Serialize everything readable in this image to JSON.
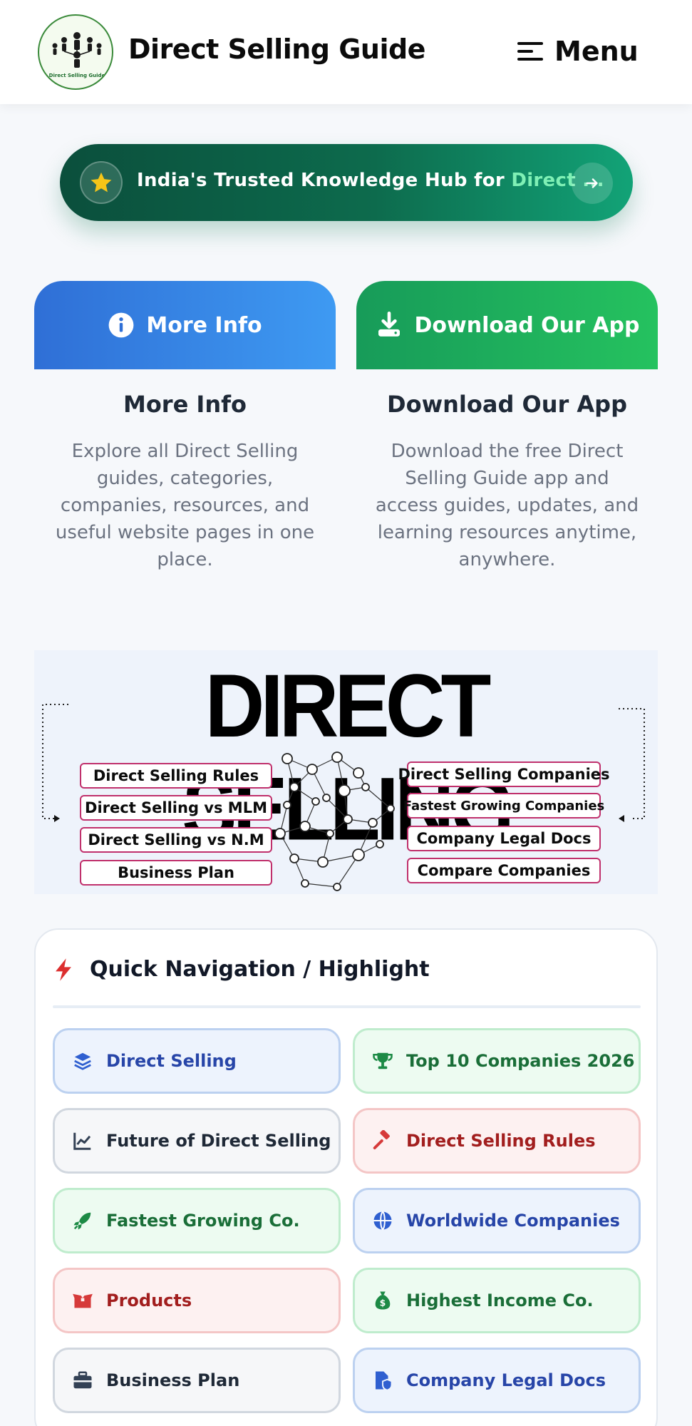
{
  "header": {
    "site_title": "Direct Selling Guide",
    "logo_text": "Direct Selling Guide",
    "menu_label": "Menu",
    "menu_icon": "hamburger-icon"
  },
  "banner": {
    "text": "India's Trusted Knowledge Hub for ",
    "highlight": "Direct ...",
    "star_icon": "star-icon",
    "arrow_icon": "arrow-right-icon",
    "colors": {
      "start": "#0b4f3c",
      "end": "#12a377",
      "highlight": "#7ff0b5",
      "star": "#f5c518"
    }
  },
  "cards": [
    {
      "button_label": "More Info",
      "icon": "info-circle-icon",
      "title": "More Info",
      "description_lines": [
        "Explore all Direct Selling",
        "guides, categories,",
        "companies, resources, and",
        "useful website pages in one",
        "place."
      ],
      "color": "#2f6fd6"
    },
    {
      "button_label": "Download Our App",
      "icon": "download-icon",
      "title": "Download Our App",
      "description_lines": [
        "Download the free Direct",
        "Selling Guide app and",
        "access guides, updates, and",
        "learning resources anytime,",
        "anywhere."
      ],
      "color": "#179b59"
    }
  ],
  "hero": {
    "title": "DIRECT SELLING",
    "left_items": [
      "Direct Selling Rules",
      "Direct Selling vs MLM",
      "Direct Selling vs N.M",
      "Business Plan"
    ],
    "right_items": [
      "Direct Selling Companies",
      "Fastest Growing Companies",
      "Company Legal Docs",
      "Compare Companies"
    ],
    "box_border_color": "#c0306c"
  },
  "quick_nav": {
    "title": "Quick Navigation / Highlight",
    "title_icon": "bolt-icon",
    "items": [
      {
        "label": "Direct Selling",
        "icon": "layers-icon",
        "variant": "blue"
      },
      {
        "label": "Top 10 Companies 2026",
        "icon": "trophy-icon",
        "variant": "green"
      },
      {
        "label": "Future of Direct Selling",
        "icon": "chart-line-icon",
        "variant": "gray"
      },
      {
        "label": "Direct Selling Rules",
        "icon": "gavel-icon",
        "variant": "red"
      },
      {
        "label": "Fastest Growing Co.",
        "icon": "rocket-icon",
        "variant": "green"
      },
      {
        "label": "Worldwide Companies",
        "icon": "globe-icon",
        "variant": "blue"
      },
      {
        "label": "Products",
        "icon": "box-open-icon",
        "variant": "red"
      },
      {
        "label": "Highest Income Co.",
        "icon": "money-bag-icon",
        "variant": "green"
      },
      {
        "label": "Business Plan",
        "icon": "briefcase-icon",
        "variant": "gray"
      },
      {
        "label": "Company Legal Docs",
        "icon": "file-shield-icon",
        "variant": "blue"
      }
    ]
  }
}
